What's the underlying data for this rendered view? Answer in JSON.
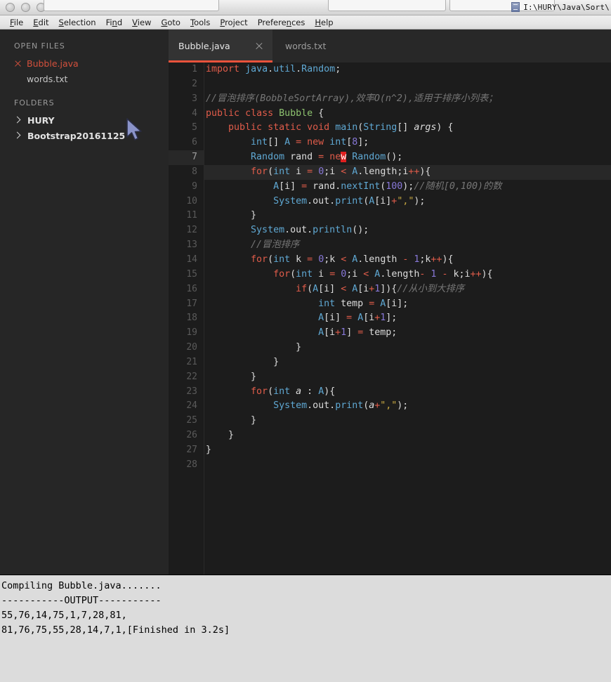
{
  "titlebar": {
    "path": "I:\\HURY\\Java\\Sort\\",
    "doc_icon": "document-icon",
    "window_buttons": [
      "close",
      "minimize",
      "zoom"
    ]
  },
  "menubar": {
    "items": [
      {
        "label": "File",
        "accesskey": "F"
      },
      {
        "label": "Edit",
        "accesskey": "E"
      },
      {
        "label": "Selection",
        "accesskey": "S"
      },
      {
        "label": "Find",
        "accesskey": "n"
      },
      {
        "label": "View",
        "accesskey": "V"
      },
      {
        "label": "Goto",
        "accesskey": "G"
      },
      {
        "label": "Tools",
        "accesskey": "T"
      },
      {
        "label": "Project",
        "accesskey": "P"
      },
      {
        "label": "Preferences",
        "accesskey": "n"
      },
      {
        "label": "Help",
        "accesskey": "H"
      }
    ]
  },
  "sidebar": {
    "open_files_header": "OPEN FILES",
    "open_files": [
      {
        "name": "Bubble.java",
        "active": true,
        "has_close": true
      },
      {
        "name": "words.txt",
        "active": false,
        "has_close": false
      }
    ],
    "folders_header": "FOLDERS",
    "folders": [
      {
        "name": "HURY",
        "expanded": false
      },
      {
        "name": "Bootstrap20161125",
        "expanded": false
      }
    ]
  },
  "editor": {
    "tabs": [
      {
        "label": "Bubble.java",
        "active": true,
        "closable": true
      },
      {
        "label": "words.txt",
        "active": false,
        "closable": false
      }
    ],
    "active_tab_accent": "#e9533c",
    "current_line": 7,
    "total_lines": 28,
    "line_numbers": [
      1,
      2,
      3,
      4,
      5,
      6,
      7,
      8,
      9,
      10,
      11,
      12,
      13,
      14,
      15,
      16,
      17,
      18,
      19,
      20,
      21,
      22,
      23,
      24,
      25,
      26,
      27,
      28
    ],
    "code": [
      "import java.util.Random;",
      "",
      "//冒泡排序(BobbleSortArray),效率O(n^2),适用于排序小列表；",
      "public class Bubble {",
      "    public static void main(String[] args) {",
      "        int[] A = new int[8];",
      "        Random rand = new Random();",
      "        for(int i = 0;i < A.length;i++){",
      "            A[i] = rand.nextInt(100);//随机[0,100)的数",
      "            System.out.print(A[i]+\",\");",
      "        }",
      "        System.out.println();",
      "        //冒泡排序",
      "        for(int k = 0;k < A.length - 1;k++){",
      "            for(int i = 0;i < A.length- 1 - k;i++){",
      "                if(A[i] < A[i+1]){//从小到大排序",
      "                    int temp = A[i];",
      "                    A[i] = A[i+1];",
      "                    A[i+1] = temp;",
      "                }",
      "            }",
      "        }",
      "        for(int a : A){",
      "            System.out.print(a+\",\");",
      "        }",
      "    }",
      "}",
      ""
    ]
  },
  "console": {
    "lines": [
      "Compiling Bubble.java.......",
      "-----------OUTPUT-----------",
      "55,76,14,75,1,7,28,81,",
      "81,76,75,55,28,14,7,1,[Finished in 3.2s]"
    ],
    "unsorted_values": [
      55,
      76,
      14,
      75,
      1,
      7,
      28,
      81
    ],
    "sorted_values": [
      81,
      76,
      75,
      55,
      28,
      14,
      7,
      1
    ],
    "finished_time": "3.2s"
  },
  "theme": {
    "editor_bg": "#1c1c1c",
    "sidebar_bg": "#262626",
    "tabbar_bg": "#282828",
    "accent": "#e9533c",
    "console_bg": "#dcdcdc"
  }
}
